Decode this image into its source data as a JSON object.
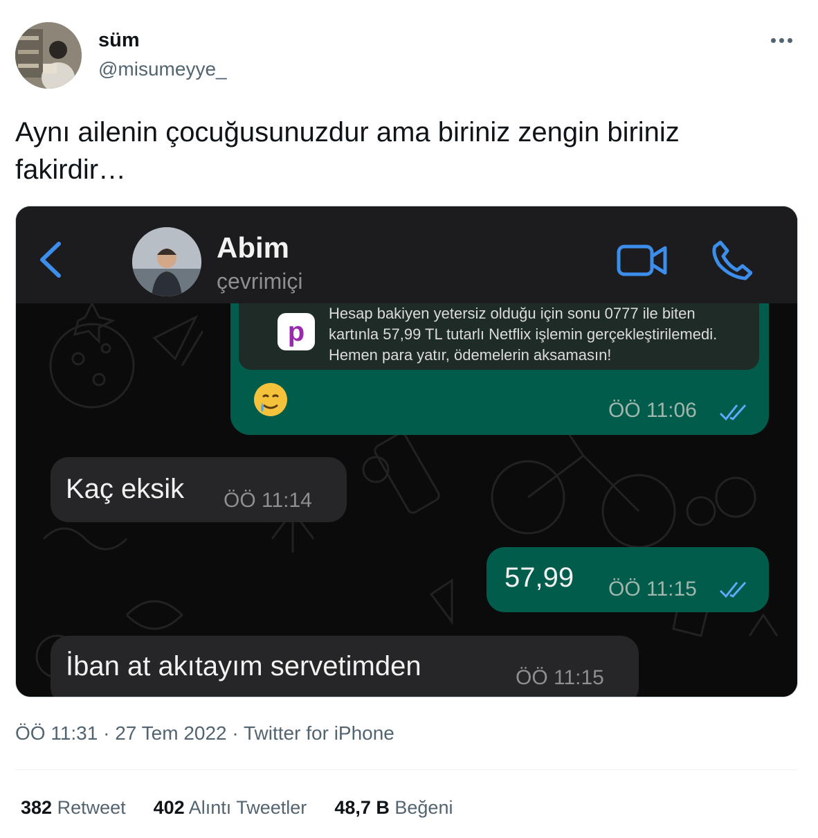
{
  "author": {
    "display_name": "süm",
    "handle": "@misumeyye_"
  },
  "tweet": {
    "text": "Aynı ailenin çocuğusunuzdur ama biriniz zengin biriniz fakirdir…"
  },
  "chat": {
    "contact_name": "Abim",
    "contact_status": "çevrimiçi",
    "quoted_notification": "Hesap bakiyen yetersiz olduğu için sonu 0777 ile biten kartınla 57,99 TL tutarlı Netflix işlemin gerçekleştirilemedi. Hemen para yatır, ödemelerin aksamasın!",
    "quoted_app_letter": "p",
    "messages": [
      {
        "direction": "out",
        "text": "🥲",
        "time": "ÖÖ 11:06"
      },
      {
        "direction": "in",
        "text": "Kaç eksik",
        "time": "ÖÖ 11:14"
      },
      {
        "direction": "out",
        "text": "57,99",
        "time": "ÖÖ 11:15"
      },
      {
        "direction": "in",
        "text": "İban at akıtayım servetimden",
        "time": "ÖÖ 11:15"
      }
    ]
  },
  "meta": {
    "time": "ÖÖ 11:31",
    "date": "27 Tem 2022",
    "source": "Twitter for iPhone",
    "separator": "·"
  },
  "stats": {
    "retweets_count": "382",
    "retweets_label": "Retweet",
    "quotes_count": "402",
    "quotes_label": "Alıntı Tweetler",
    "likes_count": "48,7 B",
    "likes_label": "Beğeni"
  },
  "colors": {
    "outgoing_bubble": "#025c4c",
    "incoming_bubble": "#262628",
    "ios_blue": "#3d8eea",
    "text_primary": "#0f1419",
    "text_secondary": "#536471"
  }
}
